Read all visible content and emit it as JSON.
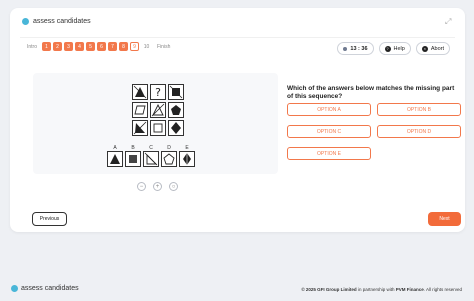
{
  "brand": {
    "name": "assess candidates"
  },
  "nav": {
    "intro": "Intro",
    "steps": [
      "1",
      "2",
      "3",
      "4",
      "5",
      "6",
      "7",
      "8",
      "9",
      "10"
    ],
    "finish": "Finish"
  },
  "controls": {
    "timer": "13 : 36",
    "help": "Help",
    "abort": "Abort"
  },
  "question": "Which of the answers below matches the missing part of this sequence?",
  "options": [
    "OPTION A",
    "OPTION B",
    "OPTION C",
    "OPTION D",
    "OPTION E"
  ],
  "answer_letters": [
    "A",
    "B",
    "C",
    "D",
    "E"
  ],
  "buttons": {
    "previous": "Previous",
    "next": "Next"
  },
  "footer": {
    "copyright": "© 2025 GFI Group Limited",
    "partner_prefix": " in partnership with ",
    "partner": "PVM Finance",
    "rights": ". All rights reserved"
  },
  "colors": {
    "accent": "#f2784b",
    "brand": "#49b6d8"
  },
  "icons": {
    "expand": "expand-icon",
    "help": "question-icon",
    "abort": "close-icon",
    "zoom": [
      "zoom-out-icon",
      "zoom-in-icon",
      "zoom-reset-icon"
    ]
  }
}
